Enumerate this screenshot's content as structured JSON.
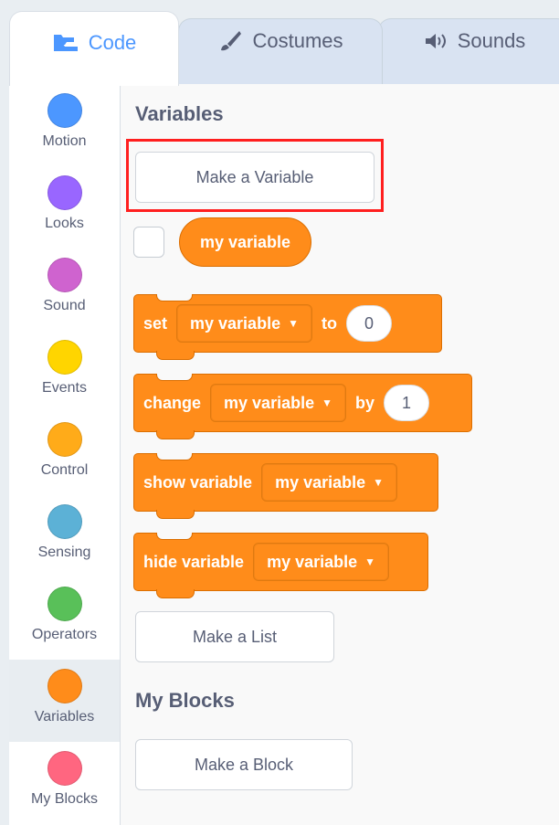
{
  "tabs": [
    {
      "label": "Code",
      "icon": "code-icon",
      "active": true
    },
    {
      "label": "Costumes",
      "icon": "brush-icon",
      "active": false
    },
    {
      "label": "Sounds",
      "icon": "speaker-icon",
      "active": false
    }
  ],
  "categories": [
    {
      "label": "Motion",
      "color": "#4c97ff"
    },
    {
      "label": "Looks",
      "color": "#9966ff"
    },
    {
      "label": "Sound",
      "color": "#cf63cf"
    },
    {
      "label": "Events",
      "color": "#ffd500"
    },
    {
      "label": "Control",
      "color": "#ffab19"
    },
    {
      "label": "Sensing",
      "color": "#5cb1d6"
    },
    {
      "label": "Operators",
      "color": "#59c059"
    },
    {
      "label": "Variables",
      "color": "#ff8c1a",
      "selected": true
    },
    {
      "label": "My Blocks",
      "color": "#ff6680"
    }
  ],
  "palette": {
    "variables_heading": "Variables",
    "make_variable": "Make a Variable",
    "variable_reporter": "my variable",
    "set_block": {
      "label": "set",
      "var": "my variable",
      "to": "to",
      "value": "0"
    },
    "change_block": {
      "label": "change",
      "var": "my variable",
      "by": "by",
      "value": "1"
    },
    "show_block": {
      "label": "show variable",
      "var": "my variable"
    },
    "hide_block": {
      "label": "hide variable",
      "var": "my variable"
    },
    "make_list": "Make a List",
    "myblocks_heading": "My Blocks",
    "make_block": "Make a Block"
  },
  "colors": {
    "variables": "#ff8c1a",
    "highlight": "#ff1f1f"
  }
}
